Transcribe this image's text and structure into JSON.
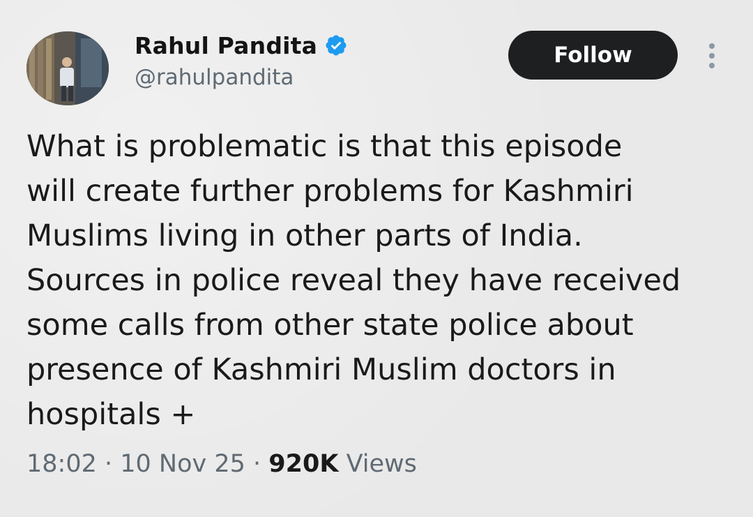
{
  "author": {
    "display_name": "Rahul Pandita",
    "handle": "@rahulpandita",
    "verified": true,
    "avatar_icon": "user-avatar-photo"
  },
  "actions": {
    "follow_label": "Follow",
    "more_icon": "vertical-ellipsis-icon"
  },
  "tweet": {
    "text_lines": [
      "What is problematic is that this episode",
      "will create further problems for Kashmiri",
      "Muslims living in other parts of India.",
      "Sources in police reveal they have received",
      "some calls from other state police about",
      "presence of Kashmiri Muslim doctors in",
      "hospitals +"
    ]
  },
  "meta": {
    "time": "18:02",
    "separator": " · ",
    "date": "10 Nov 25",
    "views_count": "920K",
    "views_label": "Views"
  },
  "colors": {
    "background": "#e9e9e9",
    "follow_button_bg": "#1d1f21",
    "verified_badge": "#1d9bf0",
    "secondary_text": "#5f6a73"
  }
}
